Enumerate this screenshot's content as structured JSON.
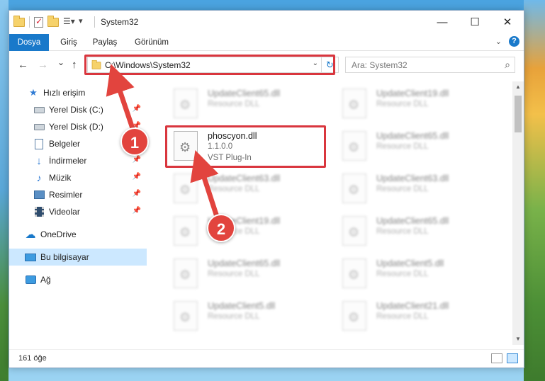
{
  "window": {
    "title": "System32"
  },
  "ribbon": {
    "tabs": [
      "Dosya",
      "Giriş",
      "Paylaş",
      "Görünüm"
    ]
  },
  "nav": {
    "back": "←",
    "forward": "→",
    "recent": "⌄",
    "up": "↑",
    "address": "C:\\Windows\\System32",
    "search_placeholder": "Ara: System32"
  },
  "sidebar": {
    "items": [
      {
        "label": "Hızlı erişim",
        "icon": "star-icon"
      },
      {
        "label": "Yerel Disk (C:)",
        "icon": "disk-icon",
        "pinned": true
      },
      {
        "label": "Yerel Disk (D:)",
        "icon": "disk-icon",
        "pinned": true
      },
      {
        "label": "Belgeler",
        "icon": "document-icon",
        "pinned": true
      },
      {
        "label": "İndirmeler",
        "icon": "download-icon",
        "pinned": true
      },
      {
        "label": "Müzik",
        "icon": "music-icon",
        "pinned": true
      },
      {
        "label": "Resimler",
        "icon": "pictures-icon",
        "pinned": true
      },
      {
        "label": "Videolar",
        "icon": "video-icon",
        "pinned": true
      },
      {
        "label": "OneDrive",
        "icon": "cloud-icon"
      },
      {
        "label": "Bu bilgisayar",
        "icon": "computer-icon",
        "selected": true
      },
      {
        "label": "Ağ",
        "icon": "network-icon"
      }
    ]
  },
  "files": {
    "left": [
      {
        "name": "UpdateClient65.dll",
        "sub1": "Resource DLL"
      },
      {
        "name": "phoscyon.dll",
        "sub1": "1.1.0.0",
        "sub2": "VST Plug-In",
        "highlighted": true
      },
      {
        "name": "UpdateClient63.dll",
        "sub1": "Resource DLL"
      },
      {
        "name": "UpdateClient19.dll",
        "sub1": "Resource DLL"
      },
      {
        "name": "UpdateClient65.dll",
        "sub1": "Resource DLL"
      },
      {
        "name": "UpdateClient5.dll",
        "sub1": "Resource DLL"
      }
    ],
    "right": [
      {
        "name": "UpdateClient19.dll",
        "sub1": "Resource DLL"
      },
      {
        "name": "UpdateClient65.dll",
        "sub1": "Resource DLL"
      },
      {
        "name": "UpdateClient63.dll",
        "sub1": "Resource DLL"
      },
      {
        "name": "UpdateClient65.dll",
        "sub1": "Resource DLL"
      },
      {
        "name": "UpdateClient5.dll",
        "sub1": "Resource DLL"
      },
      {
        "name": "UpdateClient21.dll",
        "sub1": "Resource DLL"
      }
    ]
  },
  "status": {
    "count": "161 öğe"
  },
  "annotations": {
    "badge1": "1",
    "badge2": "2"
  },
  "colors": {
    "accent": "#1979ca",
    "highlight": "#d9363e",
    "selection": "#cce8ff"
  }
}
